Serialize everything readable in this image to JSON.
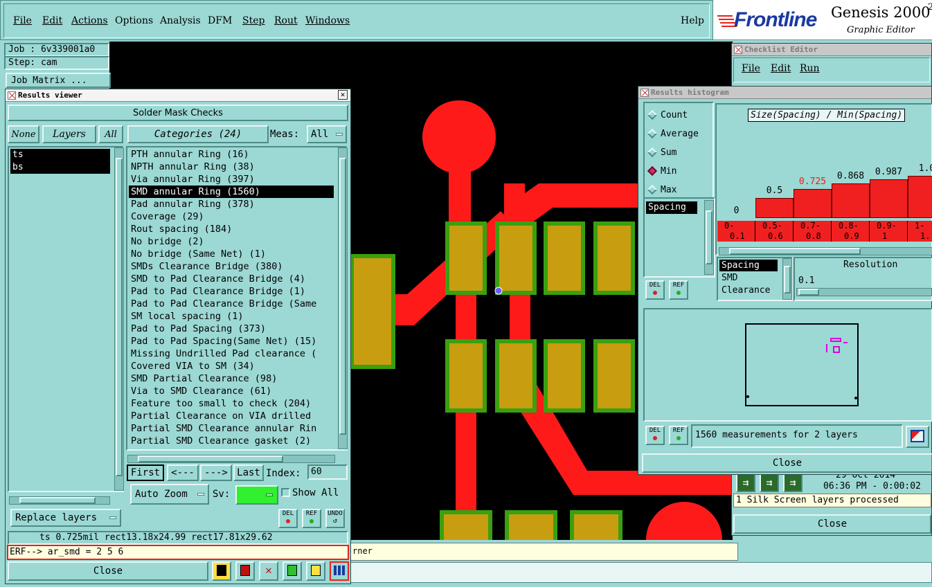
{
  "menubar": {
    "items": [
      {
        "label": "File",
        "underline": true
      },
      {
        "label": "Edit",
        "underline": true
      },
      {
        "label": "Actions",
        "underline": true
      },
      {
        "label": "Options",
        "underline": false
      },
      {
        "label": "Analysis",
        "underline": false
      },
      {
        "label": "DFM",
        "underline": false
      },
      {
        "label": "Step",
        "underline": true
      },
      {
        "label": "Rout",
        "underline": true
      },
      {
        "label": "Windows",
        "underline": true
      }
    ],
    "help": "Help"
  },
  "brand": {
    "logo": "Frontline",
    "product": "Genesis 2000",
    "superscript": "2",
    "subtitle": "Graphic Editor"
  },
  "job": {
    "job_label": "Job : 6v339001a0",
    "step_label": "Step: cam",
    "matrix_button": "Job Matrix ..."
  },
  "results_viewer": {
    "title": "Results viewer",
    "section_title": "Solder Mask Checks",
    "none_btn": "None",
    "layers_btn": "Layers",
    "all_btn": "All",
    "categories_btn": "Categories (24)",
    "meas_label": "Meas:",
    "meas_value": "All",
    "layers": [
      {
        "name": "ts",
        "selected": true
      },
      {
        "name": "bs",
        "selected": true
      }
    ],
    "categories": [
      {
        "label": "PTH annular Ring (16)",
        "selected": false
      },
      {
        "label": "NPTH annular Ring (38)",
        "selected": false
      },
      {
        "label": "Via annular Ring (397)",
        "selected": false
      },
      {
        "label": "SMD annular Ring (1560)",
        "selected": true
      },
      {
        "label": "Pad annular Ring (378)",
        "selected": false
      },
      {
        "label": "Coverage (29)",
        "selected": false
      },
      {
        "label": "Rout spacing (184)",
        "selected": false
      },
      {
        "label": "No bridge (2)",
        "selected": false
      },
      {
        "label": "No bridge (Same Net) (1)",
        "selected": false
      },
      {
        "label": "SMDs Clearance Bridge (380)",
        "selected": false
      },
      {
        "label": "SMD to Pad Clearance Bridge (4)",
        "selected": false
      },
      {
        "label": "Pad to Pad Clearance Bridge (1)",
        "selected": false
      },
      {
        "label": "Pad to Pad Clearance Bridge (Same",
        "selected": false
      },
      {
        "label": "SM local spacing (1)",
        "selected": false
      },
      {
        "label": "Pad to Pad Spacing (373)",
        "selected": false
      },
      {
        "label": "Pad to Pad Spacing(Same Net) (15)",
        "selected": false
      },
      {
        "label": "Missing Undrilled Pad clearance (",
        "selected": false
      },
      {
        "label": "Covered VIA to SM (34)",
        "selected": false
      },
      {
        "label": "SMD Partial Clearance (98)",
        "selected": false
      },
      {
        "label": "Via to SMD Clearance (61)",
        "selected": false
      },
      {
        "label": "Feature too small to check (204)",
        "selected": false
      },
      {
        "label": "Partial Clearance on VIA drilled",
        "selected": false
      },
      {
        "label": "Partial SMD Clearance annular Rin",
        "selected": false
      },
      {
        "label": "Partial SMD Clearance gasket (2)",
        "selected": false
      }
    ],
    "first_btn": "First",
    "prev_btn": "<---",
    "next_btn": "--->",
    "last_btn": "Last",
    "index_label": "Index:",
    "index_value": "60",
    "zoom_btn": "Auto Zoom",
    "sv_label": "Sv:",
    "show_all_label": "Show All",
    "replace_btn": "Replace layers",
    "del_btn": "DEL",
    "ref_btn": "REF",
    "undo_btn": "UNDO",
    "status": "ts 0.725mil  rect13.18x24.99  rect17.81x29.62",
    "erf_line": "ERF--> ar_smd = 2 5 6",
    "close_btn": "Close"
  },
  "background_message": "rner",
  "checklist_editor": {
    "title": "Checklist Editor",
    "menu": [
      "File",
      "Edit",
      "Run"
    ],
    "date_line": "29 Oct 2014",
    "time_line": "06:36 PM - 0:00:02",
    "message": "1 Silk Screen layers processed",
    "close_btn": "Close"
  },
  "histogram": {
    "title": "Results histogram",
    "modes": [
      {
        "label": "Count",
        "selected": false
      },
      {
        "label": "Average",
        "selected": false
      },
      {
        "label": "Sum",
        "selected": false
      },
      {
        "label": "Min",
        "selected": true
      },
      {
        "label": "Max",
        "selected": false
      }
    ],
    "chart_title": "Size(Spacing) / Min(Spacing)",
    "measure_list": [
      "Spacing"
    ],
    "sub_list": [
      "Spacing",
      "SMD",
      "Clearance"
    ],
    "resolution_label": "Resolution",
    "resolution_value": "0.1",
    "summary": "1560 measurements for 2 layers",
    "close_btn": "Close",
    "del_btn": "DEL",
    "ref_btn": "REF",
    "bins": [
      {
        "range": "0-0.1",
        "line1": "0-",
        "line2": "0.1",
        "value": "0",
        "level": 0.0,
        "highlight": false
      },
      {
        "range": "0.5-0.6",
        "line1": "0.5-",
        "line2": "0.6",
        "value": "0.5",
        "level": 0.36,
        "highlight": false
      },
      {
        "range": "0.7-0.8",
        "line1": "0.7-",
        "line2": "0.8",
        "value": "0.725",
        "level": 0.52,
        "highlight": true
      },
      {
        "range": "0.8-0.9",
        "line1": "0.8-",
        "line2": "0.9",
        "value": "0.868",
        "level": 0.62,
        "highlight": false
      },
      {
        "range": "0.9-1",
        "line1": "0.9-",
        "line2": "1",
        "value": "0.987",
        "level": 0.7,
        "highlight": false
      },
      {
        "range": "1-1.",
        "line1": "1-",
        "line2": "1.",
        "value": "1.0",
        "level": 0.76,
        "highlight": false
      }
    ]
  },
  "colors": {
    "panel": "#9cd8d4",
    "pcb_background": "#000000",
    "copper": "#ff1a1a",
    "pad_fill": "#c89e10",
    "pad_border": "#3aa010",
    "highlight_text": "#e8201a"
  }
}
